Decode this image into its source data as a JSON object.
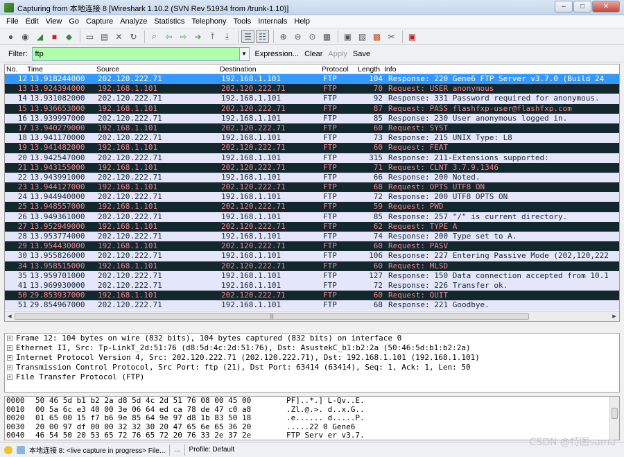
{
  "window": {
    "title": "Capturing from 本地连接 8   [Wireshark 1.10.2  (SVN Rev 51934 from /trunk-1.10)]",
    "minimize": "–",
    "maximize": "□",
    "close": "✕"
  },
  "menu": [
    "File",
    "Edit",
    "View",
    "Go",
    "Capture",
    "Analyze",
    "Statistics",
    "Telephony",
    "Tools",
    "Internals",
    "Help"
  ],
  "filter": {
    "label": "Filter:",
    "value": "ftp",
    "expression": "Expression...",
    "clear": "Clear",
    "apply": "Apply",
    "save": "Save",
    "value_bg": "#afffaf"
  },
  "columns": {
    "no": "No.",
    "time": "Time",
    "source": "Source",
    "destination": "Destination",
    "protocol": "Protocol",
    "length": "Length",
    "info": "Info"
  },
  "packets": [
    {
      "no": "12",
      "time": "13.918244000",
      "src": "202.120.222.71",
      "dst": "192.168.1.101",
      "proto": "FTP",
      "len": "104",
      "info": "Response: 220 Gene6 FTP Server v3.7.0  (Build 24",
      "kind": "sel"
    },
    {
      "no": "13",
      "time": "13.924394000",
      "src": "192.168.1.101",
      "dst": "202.120.222.71",
      "proto": "FTP",
      "len": "70",
      "info": "Request: USER anonymous",
      "kind": "req"
    },
    {
      "no": "14",
      "time": "13.931082000",
      "src": "202.120.222.71",
      "dst": "192.168.1.101",
      "proto": "FTP",
      "len": "92",
      "info": "Response: 331 Password required for anonymous.",
      "kind": "resp"
    },
    {
      "no": "15",
      "time": "13.936653000",
      "src": "192.168.1.101",
      "dst": "202.120.222.71",
      "proto": "FTP",
      "len": "87",
      "info": "Request: PASS flashfxp-user@flashfxp.com",
      "kind": "req"
    },
    {
      "no": "16",
      "time": "13.939997000",
      "src": "202.120.222.71",
      "dst": "192.168.1.101",
      "proto": "FTP",
      "len": "85",
      "info": "Response: 230 User anonymous logged in.",
      "kind": "resp"
    },
    {
      "no": "17",
      "time": "13.940279000",
      "src": "192.168.1.101",
      "dst": "202.120.222.71",
      "proto": "FTP",
      "len": "60",
      "info": "Request: SYST",
      "kind": "req"
    },
    {
      "no": "18",
      "time": "13.941170000",
      "src": "202.120.222.71",
      "dst": "192.168.1.101",
      "proto": "FTP",
      "len": "73",
      "info": "Response: 215 UNIX Type: L8",
      "kind": "resp"
    },
    {
      "no": "19",
      "time": "13.941482000",
      "src": "192.168.1.101",
      "dst": "202.120.222.71",
      "proto": "FTP",
      "len": "60",
      "info": "Request: FEAT",
      "kind": "req"
    },
    {
      "no": "20",
      "time": "13.942547000",
      "src": "202.120.222.71",
      "dst": "192.168.1.101",
      "proto": "FTP",
      "len": "315",
      "info": "Response: 211-Extensions supported:",
      "kind": "resp"
    },
    {
      "no": "21",
      "time": "13.943155000",
      "src": "192.168.1.101",
      "dst": "202.120.222.71",
      "proto": "FTP",
      "len": "71",
      "info": "Request: CLNT 3.7.9.1346",
      "kind": "req"
    },
    {
      "no": "22",
      "time": "13.943991000",
      "src": "202.120.222.71",
      "dst": "192.168.1.101",
      "proto": "FTP",
      "len": "66",
      "info": "Response: 200 Noted.",
      "kind": "resp"
    },
    {
      "no": "23",
      "time": "13.944127000",
      "src": "192.168.1.101",
      "dst": "202.120.222.71",
      "proto": "FTP",
      "len": "68",
      "info": "Request: OPTS UTF8 ON",
      "kind": "req"
    },
    {
      "no": "24",
      "time": "13.944940000",
      "src": "202.120.222.71",
      "dst": "192.168.1.101",
      "proto": "FTP",
      "len": "72",
      "info": "Response: 200 UTF8 OPTS ON",
      "kind": "resp"
    },
    {
      "no": "25",
      "time": "13.948557000",
      "src": "192.168.1.101",
      "dst": "202.120.222.71",
      "proto": "FTP",
      "len": "59",
      "info": "Request: PWD",
      "kind": "req"
    },
    {
      "no": "26",
      "time": "13.949361000",
      "src": "202.120.222.71",
      "dst": "192.168.1.101",
      "proto": "FTP",
      "len": "85",
      "info": "Response: 257 \"/\" is current directory.",
      "kind": "resp"
    },
    {
      "no": "27",
      "time": "13.952949000",
      "src": "192.168.1.101",
      "dst": "202.120.222.71",
      "proto": "FTP",
      "len": "62",
      "info": "Request: TYPE A",
      "kind": "req"
    },
    {
      "no": "28",
      "time": "13.953774000",
      "src": "202.120.222.71",
      "dst": "192.168.1.101",
      "proto": "FTP",
      "len": "74",
      "info": "Response: 200 Type set to A.",
      "kind": "resp"
    },
    {
      "no": "29",
      "time": "13.954430000",
      "src": "192.168.1.101",
      "dst": "202.120.222.71",
      "proto": "FTP",
      "len": "60",
      "info": "Request: PASV",
      "kind": "req"
    },
    {
      "no": "30",
      "time": "13.955826000",
      "src": "202.120.222.71",
      "dst": "192.168.1.101",
      "proto": "FTP",
      "len": "106",
      "info": "Response: 227 Entering Passive Mode (202,120,222",
      "kind": "resp"
    },
    {
      "no": "34",
      "time": "13.958515000",
      "src": "192.168.1.101",
      "dst": "202.120.222.71",
      "proto": "FTP",
      "len": "60",
      "info": "Request: MLSD",
      "kind": "req"
    },
    {
      "no": "35",
      "time": "13.959701000",
      "src": "202.120.222.71",
      "dst": "192.168.1.101",
      "proto": "FTP",
      "len": "127",
      "info": "Response: 150 Data connection accepted from 10.1",
      "kind": "resp"
    },
    {
      "no": "41",
      "time": "13.969930000",
      "src": "202.120.222.71",
      "dst": "192.168.1.101",
      "proto": "FTP",
      "len": "72",
      "info": "Response: 226 Transfer ok.",
      "kind": "resp"
    },
    {
      "no": "50",
      "time": "29.853937000",
      "src": "192.168.1.101",
      "dst": "202.120.222.71",
      "proto": "FTP",
      "len": "60",
      "info": "Request: QUIT",
      "kind": "req"
    },
    {
      "no": "51",
      "time": "29.854967000",
      "src": "202.120.222.71",
      "dst": "192.168.1.101",
      "proto": "FTP",
      "len": "68",
      "info": "Response: 221 Goodbye.",
      "kind": "resp"
    }
  ],
  "details": [
    "Frame 12: 104 bytes on wire (832 bits), 104 bytes captured (832 bits) on interface 0",
    "Ethernet II, Src: Tp-LinkT_2d:51:76 (d8:5d:4c:2d:51:76), Dst: AsustekC_b1:b2:2a (50:46:5d:b1:b2:2a)",
    "Internet Protocol Version 4, Src: 202.120.222.71 (202.120.222.71), Dst: 192.168.1.101 (192.168.1.101)",
    "Transmission Control Protocol, Src Port: ftp (21), Dst Port: 63414 (63414), Seq: 1, Ack: 1, Len: 50",
    "File Transfer Protocol (FTP)"
  ],
  "bytes": [
    {
      "off": "0000",
      "hex": "50 46 5d b1 b2 2a d8 5d  4c 2d 51 76 08 00 45 00",
      "ascii": "PF]..*.] L-Qv..E."
    },
    {
      "off": "0010",
      "hex": "00 5a 6c e3 40 00 3e 06  64 ed ca 78 de 47 c0 a8",
      "ascii": ".Zl.@.>. d..x.G.."
    },
    {
      "off": "0020",
      "hex": "01 65 00 15 f7 b6 9e 85  64 9e 97 d8 1b 83 50 18",
      "ascii": ".e...... d.....P."
    },
    {
      "off": "0030",
      "hex": "20 00 97 df 00 00 32 32  30 20 47 65 6e 65 36 20",
      "ascii": "  .....22 0 Gene6 "
    },
    {
      "off": "0040",
      "hex": "46 54 50 20 53 65 72 76  65 72 20 76 33 2e 37 2e",
      "ascii": "FTP Serv er v3.7."
    }
  ],
  "status": {
    "capture": "本地连接 8: <live capture in progress> File...",
    "middle": "...",
    "profile": "Profile: Default"
  },
  "watermark": "CSDN @特图sama",
  "colors": {
    "request_bg": "#12272e",
    "request_fg": "#f78787",
    "response_bg": "#e6e6fa",
    "response_fg": "#12272e",
    "selected_bg": "#3399ff"
  }
}
